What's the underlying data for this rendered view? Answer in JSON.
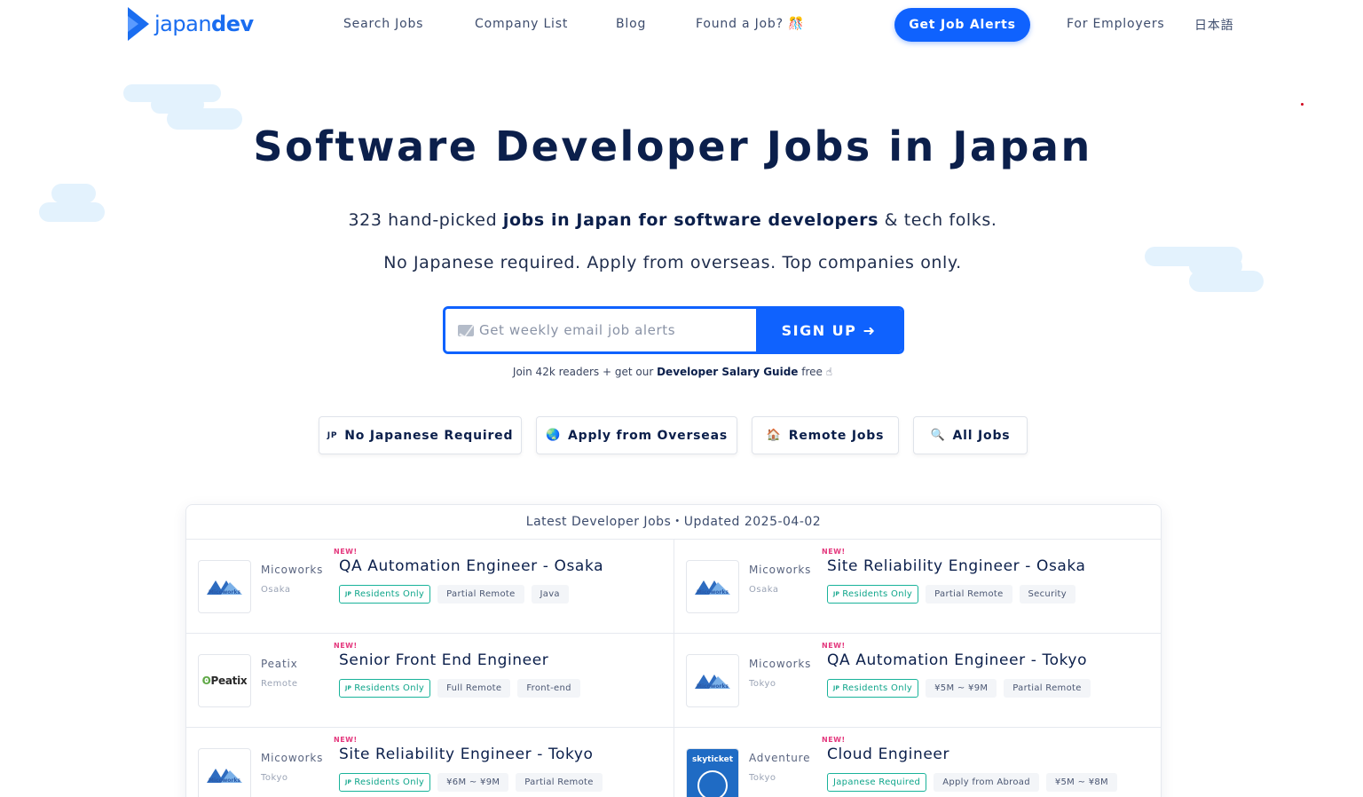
{
  "header": {
    "logo_light": "japan",
    "logo_bold": "dev",
    "nav": [
      {
        "label": "Search Jobs"
      },
      {
        "label": "Company List"
      },
      {
        "label": "Blog"
      },
      {
        "label": "Found a Job? 🎊"
      }
    ],
    "cta_label": "Get Job Alerts",
    "employers_label": "For Employers",
    "lang_label": "日本語"
  },
  "hero": {
    "title": "Software Developer Jobs in Japan",
    "sub1_pre": "323 hand-picked ",
    "sub1_bold": "jobs in Japan for software developers",
    "sub1_post": " & tech folks.",
    "sub2": "No Japanese required. Apply from overseas. Top companies only.",
    "email_placeholder": "Get weekly email job alerts",
    "signup_label": "SIGN UP ➜",
    "join_pre": "Join 42k readers + get our ",
    "join_bold": "Developer Salary Guide",
    "join_post": " free ☝"
  },
  "filters": [
    {
      "icon": "JP",
      "label": "No Japanese Required",
      "icon_name": "jp-flag-icon"
    },
    {
      "icon": "🌏",
      "label": "Apply from Overseas",
      "icon_name": "globe-icon"
    },
    {
      "icon": "🏠",
      "label": "Remote Jobs",
      "icon_name": "house-icon"
    },
    {
      "icon": "🔍",
      "label": "All Jobs",
      "icon_name": "magnifier-icon"
    }
  ],
  "board": {
    "heading": "Latest Developer Jobs・Updated 2025-04-02",
    "jobs": [
      {
        "company": "Micoworks",
        "location": "Osaka",
        "badge": "NEW!",
        "title": "QA Automation Engineer - Osaka",
        "logo": "micoworks",
        "residents": "Residents Only",
        "tags": [
          "Partial Remote",
          "Java"
        ]
      },
      {
        "company": "Micoworks",
        "location": "Osaka",
        "badge": "NEW!",
        "title": "Site Reliability Engineer - Osaka",
        "logo": "micoworks",
        "residents": "Residents Only",
        "tags": [
          "Partial Remote",
          "Security"
        ]
      },
      {
        "company": "Peatix",
        "location": "Remote",
        "badge": "NEW!",
        "title": "Senior Front End Engineer",
        "logo": "peatix",
        "residents": "Residents Only",
        "tags": [
          "Full Remote",
          "Front-end"
        ]
      },
      {
        "company": "Micoworks",
        "location": "Tokyo",
        "badge": "NEW!",
        "title": "QA Automation Engineer - Tokyo",
        "logo": "micoworks",
        "residents": "Residents Only",
        "tags": [
          "¥5M ~ ¥9M",
          "Partial Remote"
        ]
      },
      {
        "company": "Micoworks",
        "location": "Tokyo",
        "badge": "NEW!",
        "title": "Site Reliability Engineer - Tokyo",
        "logo": "micoworks",
        "residents": "Residents Only",
        "tags": [
          "¥6M ~ ¥9M",
          "Partial Remote"
        ]
      },
      {
        "company": "Adventure",
        "location": "Tokyo",
        "badge": "NEW!",
        "title": "Cloud Engineer",
        "logo": "skyticket",
        "residents": "Japanese Required",
        "tags": [
          "Apply from Abroad",
          "¥5M ~ ¥8M"
        ]
      }
    ],
    "logo_text": {
      "micoworks": "Micoworks",
      "peatix_o": "ʘ",
      "peatix": "Peatix",
      "skyticket": "skyticket"
    }
  },
  "colors": {
    "brand": "#0f62fe",
    "navy": "#0b1f4b",
    "badge": "#e4387d",
    "resident": "#19b39a"
  }
}
